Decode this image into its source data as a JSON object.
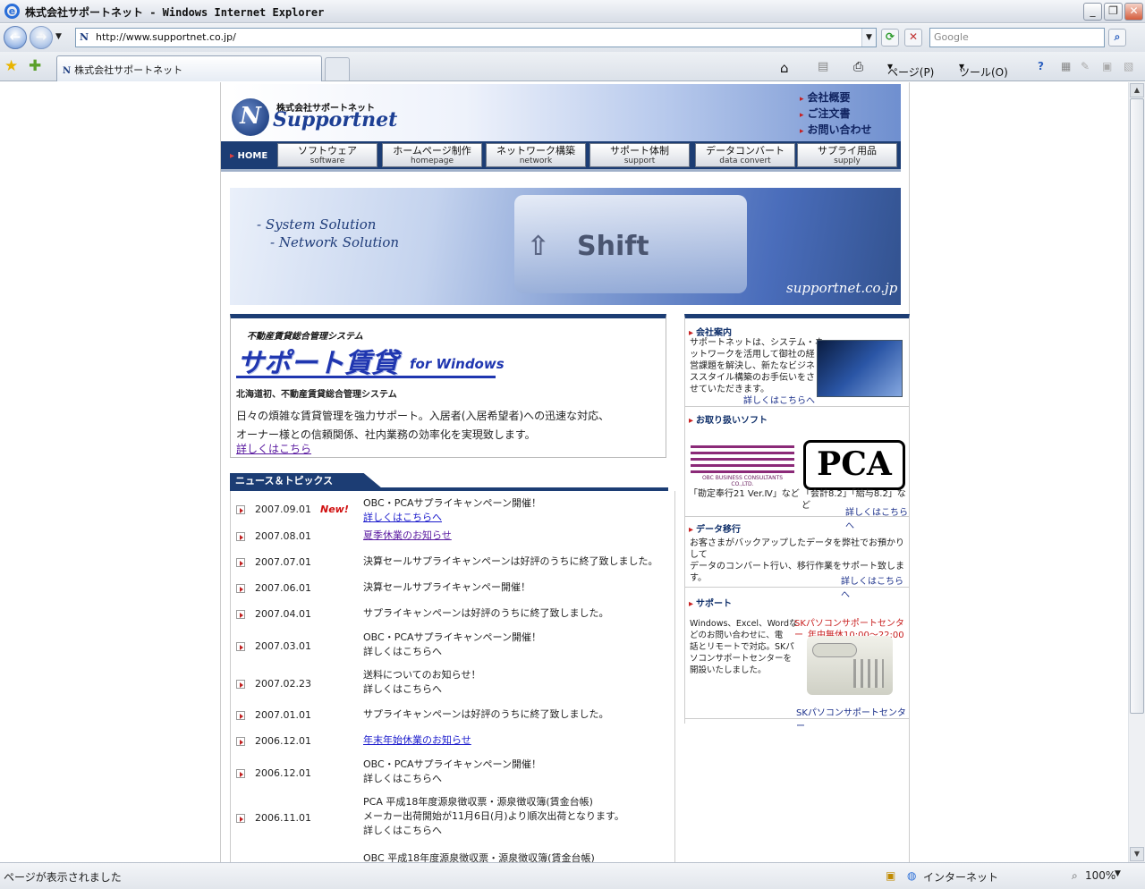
{
  "window": {
    "title": "株式会社サポートネット - Windows Internet Explorer"
  },
  "addressbar": {
    "url": "http://www.supportnet.co.jp/",
    "search_placeholder": "Google"
  },
  "tab": {
    "label": "株式会社サポートネット"
  },
  "commandbar": {
    "page": "ページ(P)",
    "tools": "ツール(O)"
  },
  "statusbar": {
    "text": "ページが表示されました",
    "zone": "インターネット",
    "zoom": "100%"
  },
  "site": {
    "logo_jp": "株式会社サポートネット",
    "logo_en": "Supportnet",
    "toplinks": [
      "会社概要",
      "ご注文書",
      "お問い合わせ"
    ],
    "home": "HOME",
    "nav": [
      {
        "jp": "ソフトウェア",
        "en": "software"
      },
      {
        "jp": "ホームページ制作",
        "en": "homepage"
      },
      {
        "jp": "ネットワーク構築",
        "en": "network"
      },
      {
        "jp": "サポート体制",
        "en": "support"
      },
      {
        "jp": "データコンバート",
        "en": "data convert"
      },
      {
        "jp": "サプライ用品",
        "en": "supply"
      }
    ],
    "hero": {
      "sol1": "- System Solution",
      "sol2": "- Network Solution",
      "key": "Shift",
      "domain": "supportnet.co.jp"
    },
    "product": {
      "kicker": "不動産賃貸総合管理システム",
      "title": "サポート賃貸",
      "for": "for Windows",
      "sub": "北海道初、不動産賃貸総合管理システム",
      "desc1": "日々の煩雑な賃貸管理を強力サポート。入居者(入居希望者)への迅速な対応、",
      "desc2": "オーナー様との信頼関係、社内業務の効率化を実現致します。",
      "more": "詳しくはこちら"
    },
    "news_title": "ニュース＆トピックス",
    "news": [
      {
        "date": "2007.09.01",
        "new": "New!",
        "line1": "OBC・PCAサプライキャンペーン開催！",
        "line2": "詳しくはこちらへ"
      },
      {
        "date": "2007.08.01",
        "new": "",
        "line1": "夏季休業のお知らせ",
        "line2": ""
      },
      {
        "date": "2007.07.01",
        "new": "",
        "line1": "決算セールサプライキャンペーンは好評のうちに終了致しました。",
        "line2": ""
      },
      {
        "date": "2007.06.01",
        "new": "",
        "line1": "決算セールサプライキャンペー開催！",
        "line2": ""
      },
      {
        "date": "2007.04.01",
        "new": "",
        "line1": "サプライキャンペーンは好評のうちに終了致しました。",
        "line2": ""
      },
      {
        "date": "2007.03.01",
        "new": "",
        "line1": "OBC・PCAサプライキャンペーン開催！",
        "line2": "詳しくはこちらへ"
      },
      {
        "date": "2007.02.23",
        "new": "",
        "line1": "送料についてのお知らせ！",
        "line2": "詳しくはこちらへ"
      },
      {
        "date": "2007.01.01",
        "new": "",
        "line1": "サプライキャンペーンは好評のうちに終了致しました。",
        "line2": ""
      },
      {
        "date": "2006.12.01",
        "new": "",
        "line1": "年末年始休業のお知らせ",
        "line2": ""
      },
      {
        "date": "2006.12.01",
        "new": "",
        "line1": "OBC・PCAサプライキャンペーン開催！",
        "line2": "詳しくはこちらへ"
      },
      {
        "date": "2006.11.01",
        "new": "",
        "line1": "PCA 平成18年度源泉徴収票・源泉徴収簿(賃金台帳)",
        "line2": "メーカー出荷開始が11月6日(月)より順次出荷となります。",
        "line3": "詳しくはこちらへ"
      },
      {
        "date": "",
        "new": "",
        "line1": "OBC 平成18年度源泉徴収票・源泉徴収簿(賃金台帳)",
        "line2": ""
      }
    ],
    "right": {
      "about_head": "会社案内",
      "about_text": [
        "サポートネットは、システム・ネ",
        "ットワークを活用して御社の経",
        "営課題を解決し、新たなビジネ",
        "ススタイル構築のお手伝いをさ",
        "せていただきます。"
      ],
      "about_more": "詳しくはこちらへ",
      "soft_head": "お取り扱いソフト",
      "obc_caption": "OBC BUSINESS CONSULTANTS CO.,LTD.",
      "pca_logo": "PCA",
      "obc_label": "「勘定奉行21 Ver.Ⅳ」など",
      "pca_label": "「会計8.2」「給与8.2」など",
      "soft_more": "詳しくはこちらへ",
      "data_head": "データ移行",
      "data_text": [
        "お客さまがバックアップしたデータを弊社でお預かりして",
        "データのコンバート行い、移行作業をサポート致します。"
      ],
      "data_more": "詳しくはこちらへ",
      "support_head": "サポート",
      "support_text": [
        "Windows、Excel、Wordな",
        "どのお問い合わせに、電",
        "話とリモートで対応。SKパ",
        "ソコンサポートセンターを",
        "開設いたしました。"
      ],
      "sk_name": "SKパソコンサポートセンター",
      "sk_hours": "年中無休10:00～22:00",
      "sk_link": "SKパソコンサポートセンター"
    }
  }
}
